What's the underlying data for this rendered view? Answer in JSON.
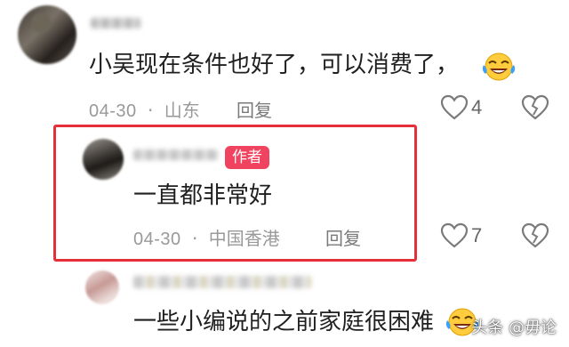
{
  "comments": [
    {
      "text": "小吴现在条件也好了，可以消费了，",
      "date": "04-30",
      "separator": "·",
      "location": "山东",
      "reply_label": "回复",
      "likes": "4"
    },
    {
      "badge": "作者",
      "text": "一直都非常好",
      "date": "04-30",
      "separator": "·",
      "location": "中国香港",
      "reply_label": "回复",
      "likes": "7"
    },
    {
      "text": "一些小编说的之前家庭很困难"
    }
  ],
  "watermark": "头条 @毋论",
  "colors": {
    "badge": "#f0435f",
    "highlight": "#e63039",
    "meta": "#999999"
  },
  "icons": [
    "heart-outline-icon",
    "broken-heart-icon",
    "laughing-crying-emoji"
  ]
}
